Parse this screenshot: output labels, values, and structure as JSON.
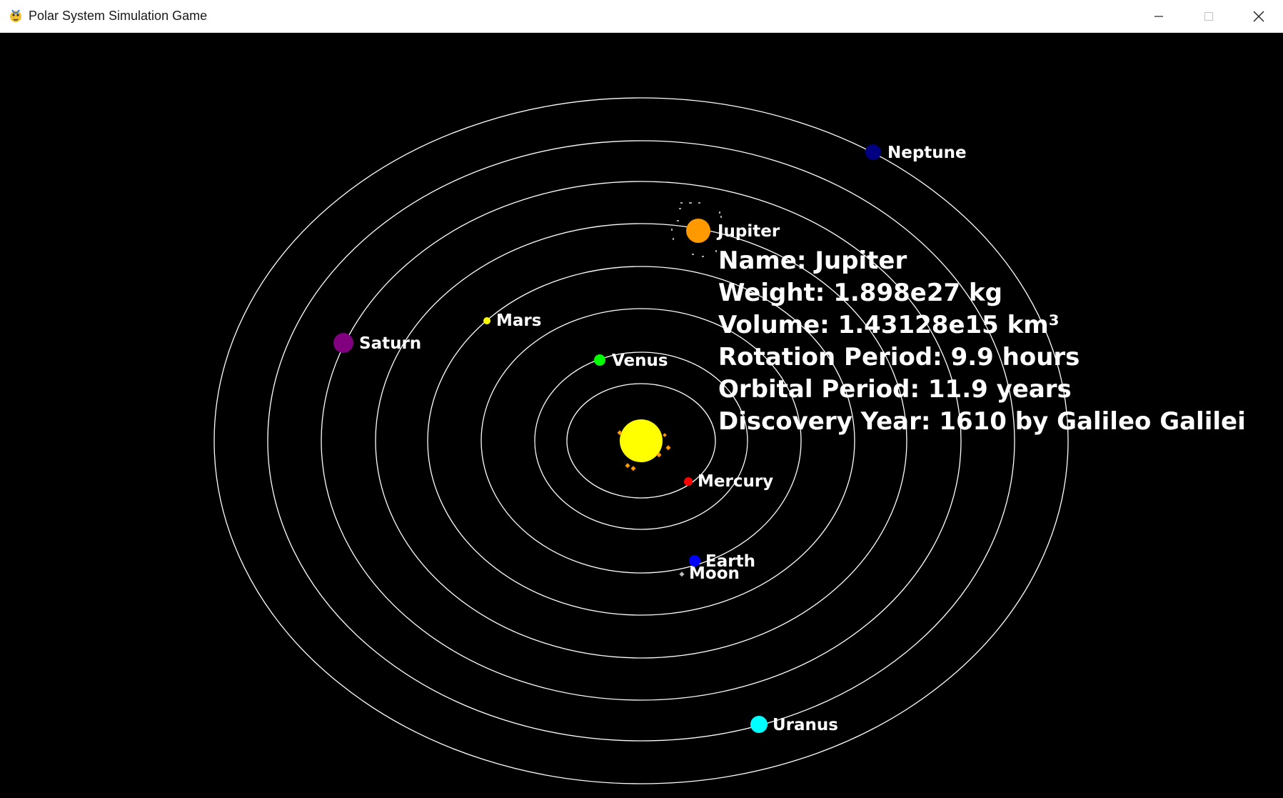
{
  "window": {
    "title": "Polar System Simulation Game",
    "app_icon": "pygame-snake-icon",
    "controls": {
      "minimize": "minimize-icon",
      "maximize": "maximize-icon",
      "close": "close-icon"
    }
  },
  "scene": {
    "background_color": "#000000",
    "orbit_color": "#ffffff",
    "sun": {
      "color": "#ffff00",
      "flare_color": "#ff9900"
    },
    "bodies": [
      {
        "name": "Mercury",
        "color": "#ff0000"
      },
      {
        "name": "Venus",
        "color": "#00ff00"
      },
      {
        "name": "Earth",
        "color": "#0000ff"
      },
      {
        "name": "Moon",
        "color": "#bbbbbb"
      },
      {
        "name": "Mars",
        "color": "#ffff00"
      },
      {
        "name": "Jupiter",
        "color": "#ff9900"
      },
      {
        "name": "Saturn",
        "color": "#800080"
      },
      {
        "name": "Uranus",
        "color": "#00ffff"
      },
      {
        "name": "Neptune",
        "color": "#000080"
      }
    ]
  },
  "info_panel": {
    "name": "Name: Jupiter",
    "weight": "Weight: 1.898e27 kg",
    "volume": "Volume: 1.43128e15 km³",
    "rotation_period": "Rotation Period: 9.9 hours",
    "orbital_period": "Orbital Period: 11.9 years",
    "discovery_year": "Discovery Year: 1610 by Galileo Galilei"
  }
}
